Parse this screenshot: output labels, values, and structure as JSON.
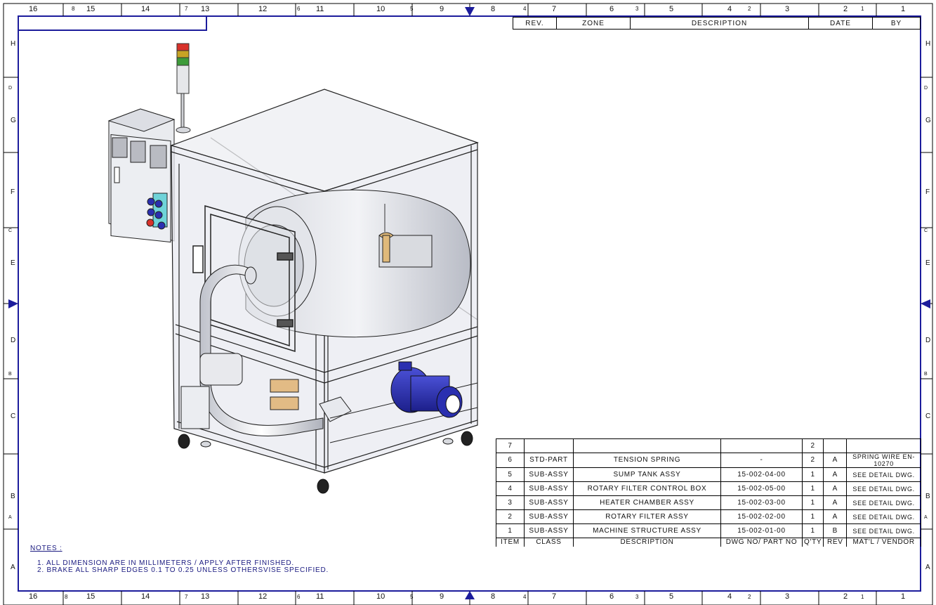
{
  "border": {
    "top_numbers": [
      "16",
      "15",
      "14",
      "13",
      "12",
      "11",
      "10",
      "9",
      "8",
      "7",
      "6",
      "5",
      "4",
      "3",
      "2",
      "1"
    ],
    "top_small": [
      "8",
      "7",
      "6",
      "5",
      "4",
      "3",
      "2",
      "1"
    ],
    "side_letters": [
      "H",
      "G",
      "F",
      "E",
      "D",
      "C",
      "B",
      "A"
    ],
    "side_small": [
      "D",
      "C",
      "B",
      "A"
    ]
  },
  "revision_block": {
    "headers": [
      "REV.",
      "ZONE",
      "DESCRIPTION",
      "DATE",
      "BY"
    ]
  },
  "bom": {
    "rows": [
      {
        "item": "7",
        "class": "",
        "description": "",
        "dwg": "",
        "qty": "2",
        "rev": "",
        "vendor": ""
      },
      {
        "item": "6",
        "class": "STD-PART",
        "description": "TENSION SPRING",
        "dwg": "-",
        "qty": "2",
        "rev": "A",
        "vendor": "SPRING WIRE EN-10270"
      },
      {
        "item": "5",
        "class": "SUB-ASSY",
        "description": "SUMP TANK ASSY",
        "dwg": "15-002-04-00",
        "qty": "1",
        "rev": "A",
        "vendor": "SEE DETAIL DWG."
      },
      {
        "item": "4",
        "class": "SUB-ASSY",
        "description": "ROTARY FILTER CONTROL BOX",
        "dwg": "15-002-05-00",
        "qty": "1",
        "rev": "A",
        "vendor": "SEE DETAIL DWG."
      },
      {
        "item": "3",
        "class": "SUB-ASSY",
        "description": "HEATER CHAMBER ASSY",
        "dwg": "15-002-03-00",
        "qty": "1",
        "rev": "A",
        "vendor": "SEE DETAIL DWG."
      },
      {
        "item": "2",
        "class": "SUB-ASSY",
        "description": "ROTARY FILTER ASSY",
        "dwg": "15-002-02-00",
        "qty": "1",
        "rev": "A",
        "vendor": "SEE DETAIL DWG."
      },
      {
        "item": "1",
        "class": "SUB-ASSY",
        "description": "MACHINE STRUCTURE ASSY",
        "dwg": "15-002-01-00",
        "qty": "1",
        "rev": "B",
        "vendor": "SEE DETAIL DWG."
      }
    ],
    "headers": {
      "item": "ITEM",
      "class": "CLASS",
      "description": "DESCRIPTION",
      "dwg": "DWG NO/ PART NO",
      "qty": "Q'TY",
      "rev": "REV",
      "vendor": "MAT'L / VENDOR"
    }
  },
  "notes": {
    "title": "NOTES :",
    "lines": [
      "1.  ALL DIMENSION ARE IN  MILLIMETERS / APPLY AFTER FINISHED.",
      "2.  BRAKE ALL SHARP EDGES 0.1 TO 0.25 UNLESS OTHERSVISE SPECIFIED."
    ]
  },
  "colors": {
    "frame": "#1c1c9c",
    "line": "#000000",
    "panel": "#eef0f4",
    "motor": "#2a2fb0"
  }
}
